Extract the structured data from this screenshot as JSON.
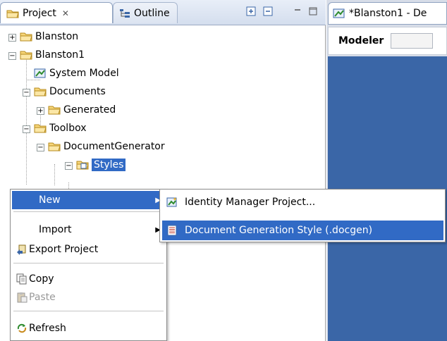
{
  "tabs": {
    "project_label": "Project",
    "project_close": "✕",
    "outline_label": "Outline"
  },
  "tree": [
    {
      "label": "Blanston",
      "toggle": "+"
    },
    {
      "label": "Blanston1",
      "toggle": "−"
    },
    {
      "label": "System Model"
    },
    {
      "label": "Documents",
      "toggle": "−"
    },
    {
      "label": "Generated",
      "toggle": "+"
    },
    {
      "label": "Toolbox",
      "toggle": "−"
    },
    {
      "label": "DocumentGenerator",
      "toggle": "−"
    },
    {
      "label": "Styles",
      "toggle": "−",
      "selected": true
    }
  ],
  "editor": {
    "tab_label": "*Blanston1 - De",
    "modeler_label": "Modeler"
  },
  "context_menu": {
    "new_label": "New",
    "import_label": "Import",
    "export_label": "Export Project",
    "copy_label": "Copy",
    "paste_label": "Paste",
    "refresh_label": "Refresh"
  },
  "submenu": {
    "identity_label": "Identity Manager Project...",
    "docgen_label": "Document Generation Style (.docgen)"
  },
  "colors": {
    "selection": "#316ac5",
    "canvas": "#3a66a7",
    "folder": "#f2c94c"
  },
  "icons": [
    "folder-icon",
    "model-icon",
    "document-style-icon",
    "project-wizard-icon",
    "export-icon",
    "copy-icon",
    "paste-icon",
    "refresh-icon"
  ]
}
